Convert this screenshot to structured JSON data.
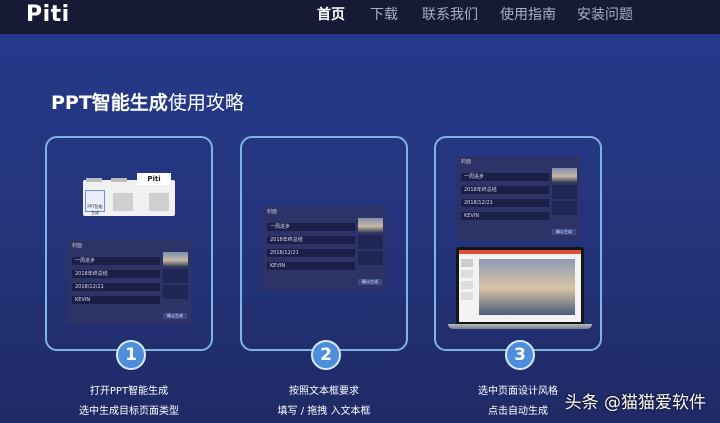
{
  "header": {
    "logo": "Piti",
    "nav": [
      {
        "label": "首页",
        "active": true
      },
      {
        "label": "下载",
        "active": false
      },
      {
        "label": "联系我们",
        "active": false
      },
      {
        "label": "使用指南",
        "active": false
      },
      {
        "label": "安装问题",
        "active": false
      }
    ]
  },
  "main": {
    "title_bold": "PPT智能生成",
    "title_rest": "使用攻略",
    "steps": [
      {
        "number": "1",
        "line1": "打开PPT智能生成",
        "line2": "选中生成目标页面类型"
      },
      {
        "number": "2",
        "line1": "按照文本框要求",
        "line2": "填写 / 拖拽 入文本框"
      },
      {
        "number": "3",
        "line1": "选中页面设计风格",
        "line2": "点击自动生成"
      }
    ],
    "form": {
      "header": "封面",
      "fields": [
        "一周进步",
        "2018年终总结",
        "2018/12/21",
        "KEVIN"
      ],
      "button": "确认生成"
    },
    "mockup": {
      "tab_label": "Piti",
      "doc_label": "PPT智能生成"
    }
  },
  "watermark": "头条 @猫猫爱软件",
  "colors": {
    "accent": "#4d8edb",
    "card_border": "#7fb3e2",
    "topbar": "#161a34"
  }
}
